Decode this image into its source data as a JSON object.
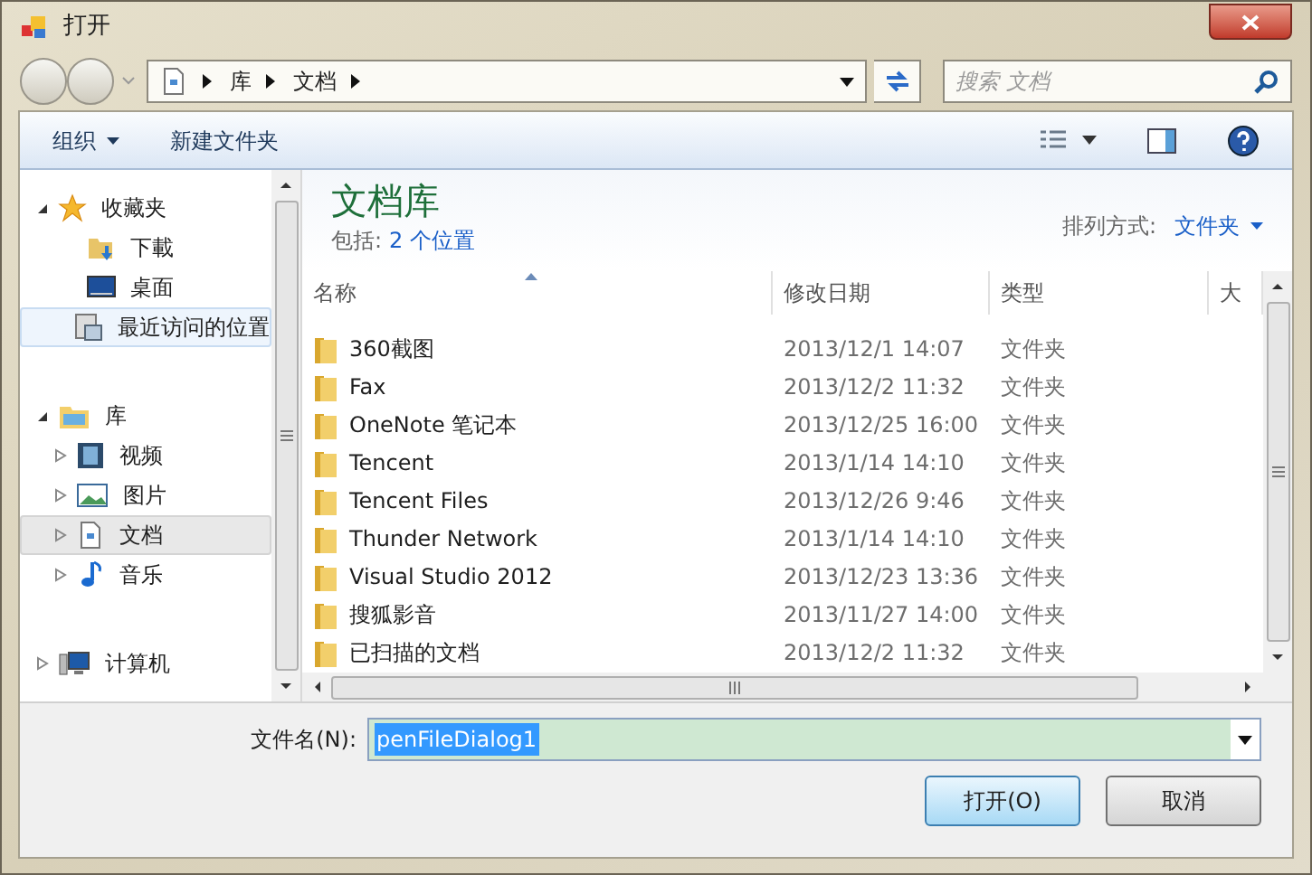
{
  "window": {
    "title": "打开"
  },
  "address": {
    "crumbs": [
      "库",
      "文档"
    ],
    "search_placeholder": "搜索 文档"
  },
  "toolbar": {
    "organize": "组织",
    "new_folder": "新建文件夹"
  },
  "sidebar": {
    "groups": [
      {
        "label": "收藏夹",
        "kind": "star",
        "expanded": true,
        "selected": false,
        "hovered": false,
        "children": [
          {
            "label": "下載",
            "kind": "download",
            "selected": false,
            "hovered": false
          },
          {
            "label": "桌面",
            "kind": "desktop",
            "selected": false,
            "hovered": false
          },
          {
            "label": "最近访问的位置",
            "kind": "recent",
            "selected": false,
            "hovered": true
          }
        ]
      },
      {
        "label": "库",
        "kind": "library",
        "expanded": true,
        "selected": false,
        "hovered": false,
        "children": [
          {
            "label": "视频",
            "kind": "video",
            "expanded": false,
            "selected": false,
            "hovered": false
          },
          {
            "label": "图片",
            "kind": "picture",
            "expanded": false,
            "selected": false,
            "hovered": false
          },
          {
            "label": "文档",
            "kind": "document",
            "expanded": false,
            "selected": true,
            "hovered": false
          },
          {
            "label": "音乐",
            "kind": "music",
            "expanded": false,
            "selected": false,
            "hovered": false
          }
        ]
      },
      {
        "label": "计算机",
        "kind": "computer",
        "expanded": false,
        "selected": false,
        "hovered": false
      }
    ]
  },
  "library": {
    "title": "文档库",
    "includes_label": "包括:",
    "includes_link": "2 个位置",
    "arrange_label": "排列方式:",
    "arrange_value": "文件夹"
  },
  "table": {
    "columns": [
      "名称",
      "修改日期",
      "类型",
      "大"
    ],
    "rows": [
      {
        "name": "360截图",
        "date": "2013/12/1 14:07",
        "type": "文件夹"
      },
      {
        "name": "Fax",
        "date": "2013/12/2 11:32",
        "type": "文件夹"
      },
      {
        "name": "OneNote 笔记本",
        "date": "2013/12/25 16:00",
        "type": "文件夹"
      },
      {
        "name": "Tencent",
        "date": "2013/1/14 14:10",
        "type": "文件夹"
      },
      {
        "name": "Tencent Files",
        "date": "2013/12/26 9:46",
        "type": "文件夹"
      },
      {
        "name": "Thunder Network",
        "date": "2013/1/14 14:10",
        "type": "文件夹"
      },
      {
        "name": "Visual Studio 2012",
        "date": "2013/12/23 13:36",
        "type": "文件夹"
      },
      {
        "name": "搜狐影音",
        "date": "2013/11/27 14:00",
        "type": "文件夹"
      },
      {
        "name": "已扫描的文档",
        "date": "2013/12/2 11:32",
        "type": "文件夹"
      }
    ]
  },
  "filename": {
    "label": "文件名(N):",
    "value": "penFileDialog1"
  },
  "buttons": [
    {
      "label": "打开(O)",
      "default": true
    },
    {
      "label": "取消",
      "default": false
    }
  ]
}
